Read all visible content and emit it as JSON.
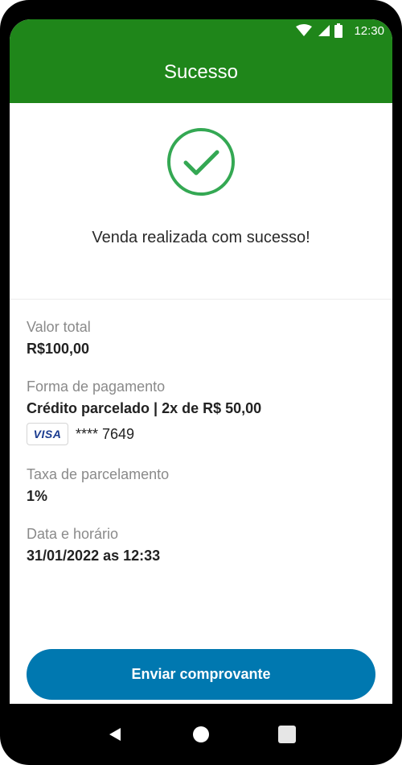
{
  "status_bar": {
    "time": "12:30",
    "icons": [
      "wifi-icon",
      "signal-icon",
      "battery-icon"
    ]
  },
  "app_bar": {
    "title": "Sucesso",
    "background_color": "#1f861a"
  },
  "success": {
    "icon": "check-circle-icon",
    "message": "Venda realizada com sucesso!",
    "icon_color": "#34a853"
  },
  "details": {
    "total": {
      "label": "Valor total",
      "value": "R$100,00"
    },
    "payment": {
      "label": "Forma de pagamento",
      "value": "Crédito parcelado | 2x de R$ 50,00",
      "card_brand": "VISA",
      "card_number": "**** 7649"
    },
    "fee": {
      "label": "Taxa de parcelamento",
      "value": "1%"
    },
    "datetime": {
      "label": "Data e horário",
      "value": "31/01/2022 as 12:33"
    }
  },
  "actions": {
    "send_receipt_label": "Enviar comprovante",
    "button_color": "#0078b0"
  },
  "nav_bar": {
    "icons": [
      "back-icon",
      "home-icon",
      "recents-icon"
    ]
  }
}
